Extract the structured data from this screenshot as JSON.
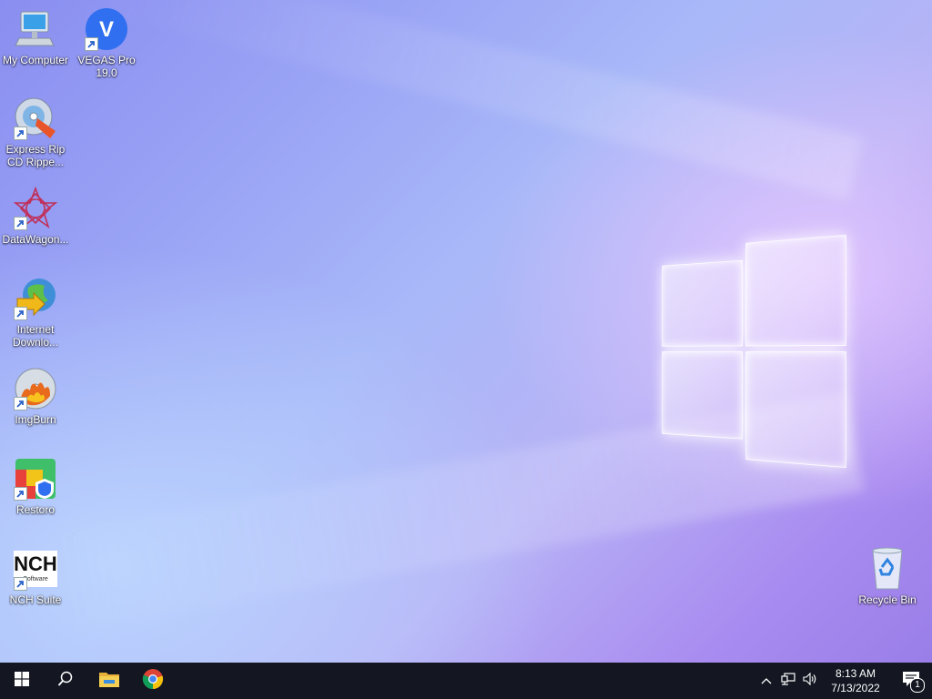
{
  "desktop": {
    "icons": [
      {
        "label": "My Computer",
        "icon": "computer-icon"
      },
      {
        "label": "VEGAS Pro\n19.0",
        "icon": "vegas-pro-icon",
        "glyph": "V"
      },
      {
        "label": "Express Rip\nCD Rippe...",
        "icon": "cd-ripper-icon"
      },
      {
        "label": "DataWagon...",
        "icon": "datawagon-icon"
      },
      {
        "label": "Internet\nDownlo...",
        "icon": "internet-download-manager-icon"
      },
      {
        "label": "ImgBurn",
        "icon": "imgburn-icon"
      },
      {
        "label": "Restoro",
        "icon": "restoro-icon"
      },
      {
        "label": "NCH Suite",
        "icon": "nch-suite-icon",
        "logo_text": "NCH",
        "logo_sub": "Software"
      },
      {
        "label": "Recycle Bin",
        "icon": "recycle-bin-icon"
      }
    ]
  },
  "taskbar": {
    "start": "windows-start-icon",
    "search": "search-icon",
    "pinned": [
      "file-explorer-icon",
      "chrome-icon"
    ],
    "tray": {
      "icons": [
        "chevron-up-icon",
        "network-icon",
        "volume-icon"
      ],
      "time": "8:13 AM",
      "date": "7/13/2022",
      "notification_count": "1"
    }
  },
  "colors": {
    "taskbar_bg": "#141722",
    "vegas_blue": "#2f6ff0",
    "restoro_red": "#e8413c",
    "restoro_green": "#3fbf6a"
  }
}
